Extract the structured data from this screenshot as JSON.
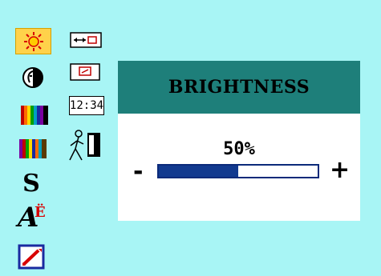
{
  "menu": {
    "title": "BRIGHTNESS",
    "value_text": "50%",
    "value_fraction": 0.5,
    "minus_label": "-",
    "plus_label": "+"
  },
  "icons": {
    "column1": [
      {
        "name": "brightness-sun-icon",
        "selected": true
      },
      {
        "name": "contrast-icon"
      },
      {
        "name": "color-bars-icon-1"
      },
      {
        "name": "color-bars-icon-2"
      },
      {
        "name": "sharpness-s-icon"
      },
      {
        "name": "language-icon"
      },
      {
        "name": "reset-icon"
      }
    ],
    "column2": [
      {
        "name": "horizontal-position-icon"
      },
      {
        "name": "image-position-icon"
      },
      {
        "name": "clock-icon",
        "label": "12:34"
      },
      {
        "name": "exit-icon"
      }
    ],
    "sharpness_label": "S",
    "language_label": "A",
    "language_sup": "Ë"
  },
  "top_strip": {
    "text": "— — —"
  },
  "colors": {
    "background": "#a8f5f5",
    "header": "#1e7f7a",
    "slider_fill": "#123a8f",
    "selected_bg": "#ffd24a"
  }
}
